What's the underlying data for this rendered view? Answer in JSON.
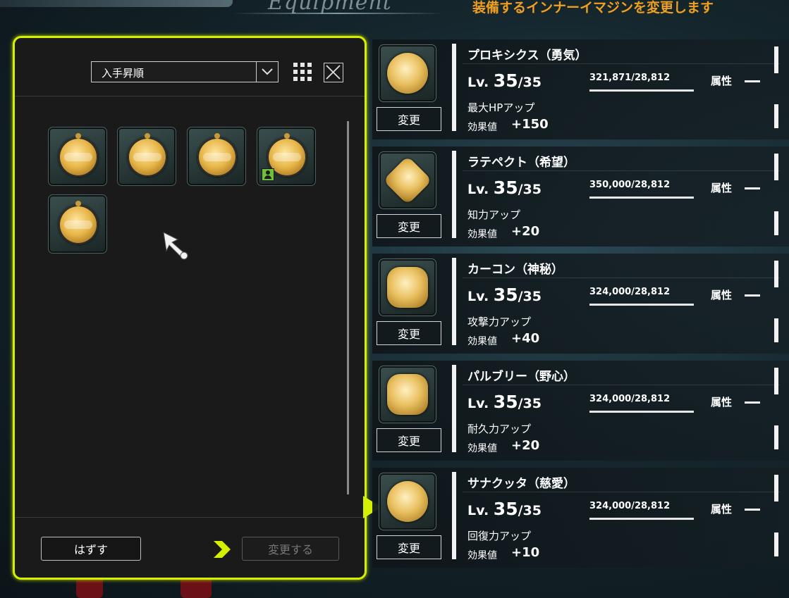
{
  "header": {
    "title": "Equipment",
    "message": "装備するインナーイマジンを変更します"
  },
  "panel": {
    "sort_label": "入手昇順",
    "remove_button": "はずす",
    "change_button": "変更する",
    "items": [
      {
        "icon": "gold-medal-icon",
        "badge": false
      },
      {
        "icon": "gold-medal-icon",
        "badge": false
      },
      {
        "icon": "gold-medal-icon",
        "badge": false
      },
      {
        "icon": "gold-medal-icon",
        "badge": true
      },
      {
        "icon": "gold-medal-icon",
        "badge": false
      }
    ]
  },
  "slots": [
    {
      "name": "プロキシクス（勇気）",
      "lv_prefix": "Lv.",
      "lv": "35",
      "lv_max": "/35",
      "exp": "321,871/28,812",
      "attr_label": "属性",
      "effect": "最大HPアップ",
      "effect_value_label": "効果値",
      "effect_value": "+150",
      "button": "変更",
      "icon": "courage-medal-icon"
    },
    {
      "name": "ラテペクト（希望）",
      "lv_prefix": "Lv.",
      "lv": "35",
      "lv_max": "/35",
      "exp": "350,000/28,812",
      "attr_label": "属性",
      "effect": "知力アップ",
      "effect_value_label": "効果値",
      "effect_value": "+20",
      "button": "変更",
      "icon": "hope-medal-icon"
    },
    {
      "name": "カーコン（神秘）",
      "lv_prefix": "Lv.",
      "lv": "35",
      "lv_max": "/35",
      "exp": "324,000/28,812",
      "attr_label": "属性",
      "effect": "攻撃力アップ",
      "effect_value_label": "効果値",
      "effect_value": "+40",
      "button": "変更",
      "icon": "mystery-medal-icon"
    },
    {
      "name": "パルブリー（野心）",
      "lv_prefix": "Lv.",
      "lv": "35",
      "lv_max": "/35",
      "exp": "324,000/28,812",
      "attr_label": "属性",
      "effect": "耐久力アップ",
      "effect_value_label": "効果値",
      "effect_value": "+20",
      "button": "変更",
      "icon": "ambition-medal-icon"
    },
    {
      "name": "サナクッタ（慈愛）",
      "lv_prefix": "Lv.",
      "lv": "35",
      "lv_max": "/35",
      "exp": "324,000/28,812",
      "attr_label": "属性",
      "effect": "回復力アップ",
      "effect_value_label": "効果値",
      "effect_value": "+10",
      "button": "変更",
      "icon": "love-medal-icon"
    }
  ],
  "colors": {
    "accent": "#d4f000",
    "header_message": "#f0a020",
    "badge": "#6fbf3a"
  }
}
